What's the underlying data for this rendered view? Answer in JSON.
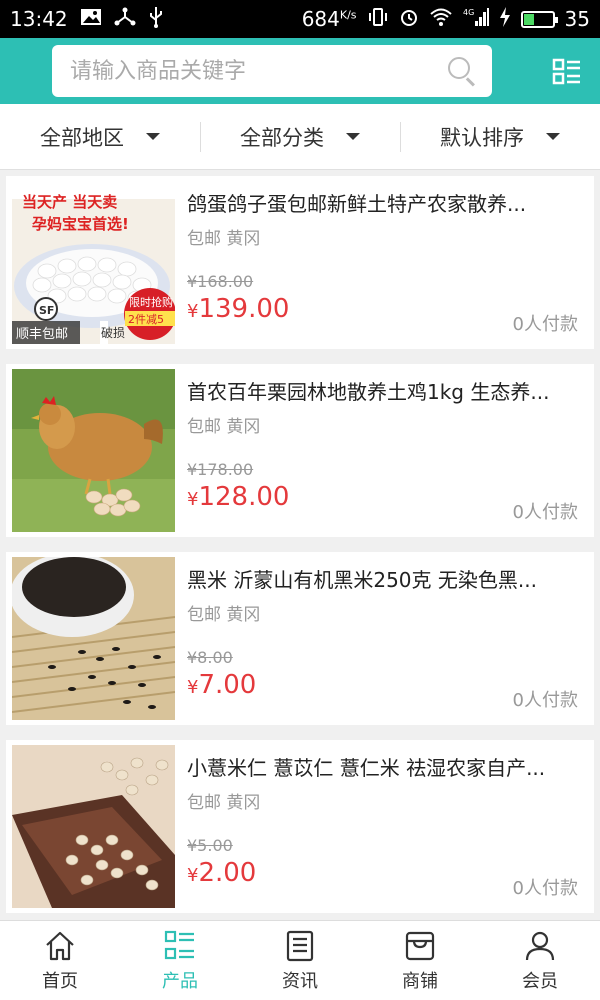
{
  "status_bar": {
    "time": "13:42",
    "speed": "684",
    "speed_unit": "K/s",
    "signal_label": "4G",
    "battery_level": "35",
    "battery_fraction": 0.35
  },
  "search": {
    "placeholder": "请输入商品关键字"
  },
  "filters": [
    {
      "label": "全部地区"
    },
    {
      "label": "全部分类"
    },
    {
      "label": "默认排序"
    }
  ],
  "products": [
    {
      "title": "鸽蛋鸽子蛋包邮新鲜土特产农家散养...",
      "meta": "包邮 黄冈",
      "old_price": "¥168.00",
      "yen": "¥",
      "price": "139.00",
      "paid": "0人付款",
      "image": "pigeon-eggs",
      "image_texts": [
        "当天产 当天卖",
        "孕妈宝宝首选!",
        "顺丰包邮",
        "限时抢购",
        "2件减5",
        "破损"
      ]
    },
    {
      "title": "首农百年栗园林地散养土鸡1kg 生态养...",
      "meta": "包邮 黄冈",
      "old_price": "¥178.00",
      "yen": "¥",
      "price": "128.00",
      "paid": "0人付款",
      "image": "free-range-chicken"
    },
    {
      "title": "黑米 沂蒙山有机黑米250克 无染色黑...",
      "meta": "包邮 黄冈",
      "old_price": "¥8.00",
      "yen": "¥",
      "price": "7.00",
      "paid": "0人付款",
      "image": "black-rice"
    },
    {
      "title": "小薏米仁 薏苡仁 薏仁米 祛湿农家自产...",
      "meta": "包邮 黄冈",
      "old_price": "¥5.00",
      "yen": "¥",
      "price": "2.00",
      "paid": "0人付款",
      "image": "job-tears"
    }
  ],
  "bottom_nav": [
    {
      "label": "首页",
      "icon": "home-icon"
    },
    {
      "label": "产品",
      "icon": "product-list-icon",
      "active": true
    },
    {
      "label": "资讯",
      "icon": "news-icon"
    },
    {
      "label": "商铺",
      "icon": "shop-icon"
    },
    {
      "label": "会员",
      "icon": "member-icon"
    }
  ],
  "colors": {
    "accent": "#2dbfb4",
    "price": "#e4393c"
  }
}
